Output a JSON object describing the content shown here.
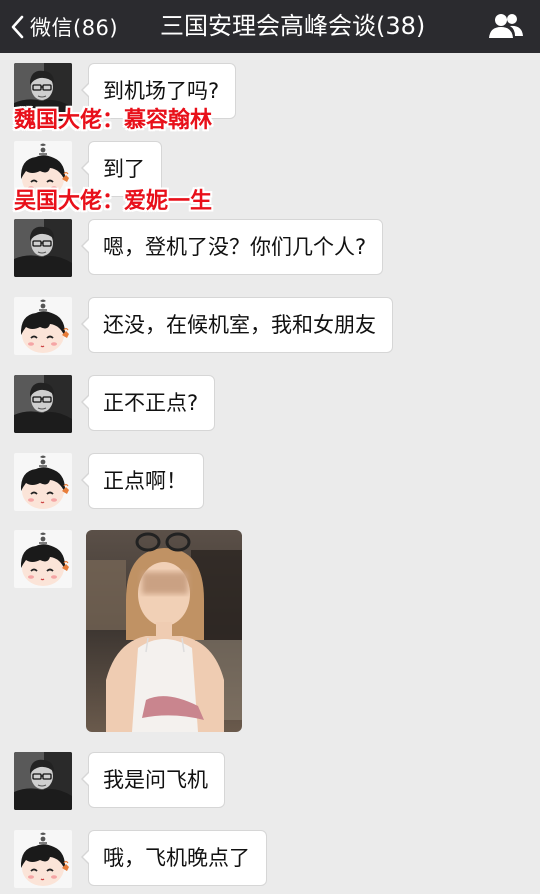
{
  "header": {
    "back_label": "微信(86)",
    "title": "三国安理会高峰会谈(38)",
    "members_icon": "group-members-icon"
  },
  "colors": {
    "header_bg": "#2b2b2f",
    "chat_bg": "#ebebeb",
    "bubble_bg": "#ffffff",
    "caption_red": "#e8101a"
  },
  "captions": {
    "wei": "魏国大佬：慕容翰林",
    "wu": "吴国大佬：爱妮一生"
  },
  "messages": [
    {
      "sender": "wei",
      "text": "到机场了吗?"
    },
    {
      "sender": "wu",
      "text": "到了"
    },
    {
      "sender": "wei",
      "text": "嗯，登机了没？你们几个人?"
    },
    {
      "sender": "wu",
      "text": "还没，在候机室，我和女朋友"
    },
    {
      "sender": "wei",
      "text": "正不正点?"
    },
    {
      "sender": "wu",
      "text": "正点啊！"
    },
    {
      "sender": "wu",
      "type": "image",
      "image": "selfie-photo"
    },
    {
      "sender": "wei",
      "text": "我是问飞机"
    },
    {
      "sender": "wu",
      "text": "哦，飞机晚点了"
    }
  ]
}
